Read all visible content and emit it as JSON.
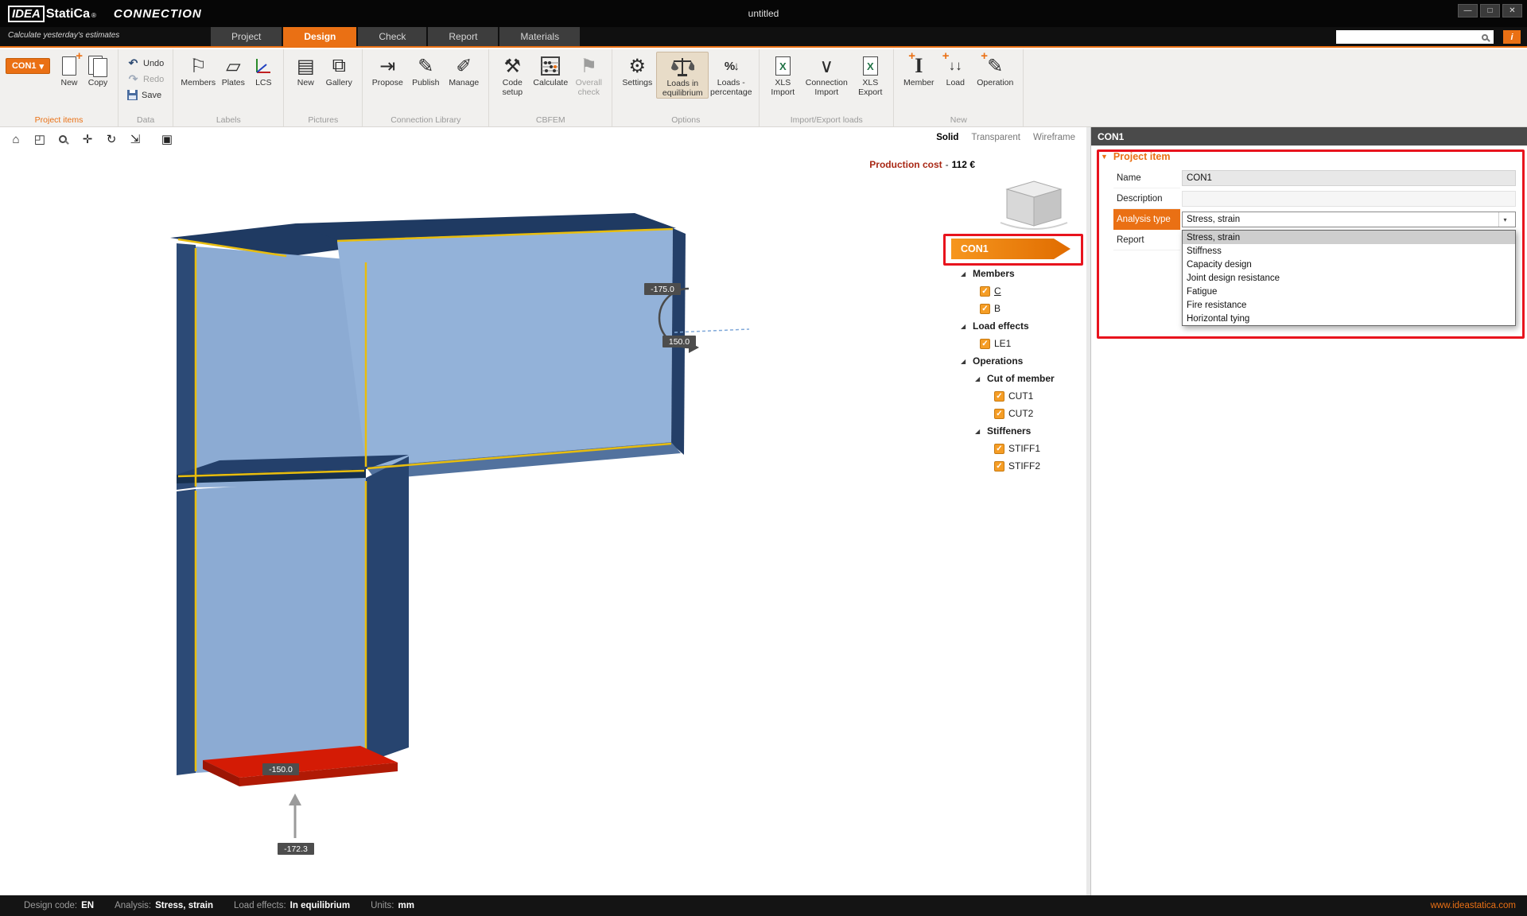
{
  "app": {
    "logo_idea": "IDEA",
    "logo_statica": "StatiCa",
    "logo_reg": "®",
    "product": "CONNECTION",
    "tagline": "Calculate yesterday's estimates",
    "window_title": "untitled"
  },
  "tabs": {
    "project": "Project",
    "design": "Design",
    "check": "Check",
    "report": "Report",
    "materials": "Materials"
  },
  "ribbon": {
    "project_items": {
      "label": "Project items",
      "con1_button": "CON1",
      "new": "New",
      "copy": "Copy"
    },
    "data": {
      "label": "Data",
      "undo": "Undo",
      "redo": "Redo",
      "save": "Save"
    },
    "labels": {
      "label": "Labels",
      "members": "Members",
      "plates": "Plates",
      "lcs": "LCS"
    },
    "pictures": {
      "label": "Pictures",
      "new": "New",
      "gallery": "Gallery"
    },
    "connection_library": {
      "label": "Connection Library",
      "propose": "Propose",
      "publish": "Publish",
      "manage": "Manage"
    },
    "cbfem": {
      "label": "CBFEM",
      "code_setup": "Code setup",
      "calculate": "Calculate",
      "overall_check": "Overall check"
    },
    "options": {
      "label": "Options",
      "settings": "Settings",
      "loads_equilibrium": "Loads in equilibrium",
      "loads_percentage": "Loads - percentage"
    },
    "import_export": {
      "label": "Import/Export loads",
      "xls_import": "XLS Import",
      "connection_import": "Connection Import",
      "xls_export": "XLS Export"
    },
    "new": {
      "label": "New",
      "member": "Member",
      "load": "Load",
      "operation": "Operation"
    }
  },
  "viewport": {
    "production_cost_label": "Production cost",
    "production_cost_sep": "-",
    "production_cost_value": "112 €",
    "view_modes": {
      "solid": "Solid",
      "transparent": "Transparent",
      "wireframe": "Wireframe"
    },
    "load_labels": {
      "moment_top": "-175.0",
      "moment_bottom": "150.0",
      "plate": "-150.0",
      "base": "-172.3"
    }
  },
  "tree": {
    "root": "CON1",
    "members_group": "Members",
    "member_c": "C",
    "member_b": "B",
    "load_effects_group": "Load effects",
    "le1": "LE1",
    "operations_group": "Operations",
    "cut_group": "Cut of member",
    "cut1": "CUT1",
    "cut2": "CUT2",
    "stiffeners_group": "Stiffeners",
    "stiff1": "STIFF1",
    "stiff2": "STIFF2"
  },
  "properties": {
    "header": "CON1",
    "section_title": "Project item",
    "name_label": "Name",
    "name_value": "CON1",
    "description_label": "Description",
    "analysis_label": "Analysis type",
    "analysis_value": "Stress, strain",
    "report_label": "Report",
    "dropdown_options": [
      "Stress, strain",
      "Stiffness",
      "Capacity design",
      "Joint design resistance",
      "Fatigue",
      "Fire resistance",
      "Horizontal tying"
    ]
  },
  "status_bar": {
    "design_code_label": "Design code:",
    "design_code_value": "EN",
    "analysis_label": "Analysis:",
    "analysis_value": "Stress, strain",
    "load_effects_label": "Load effects:",
    "load_effects_value": "In equilibrium",
    "units_label": "Units:",
    "units_value": "mm",
    "website": "www.ideastatica.com"
  },
  "colors": {
    "accent_orange": "#ea7014",
    "annotation_red": "#e8131d",
    "steel_light": "#8cabd3",
    "steel_light2": "#93b2d9",
    "steel_mid": "#52729e",
    "steel_dark": "#2c4a76",
    "steel_navy": "#1f3a62",
    "weld_yellow": "#e8bd0e",
    "plate_red": "#d41b05",
    "plate_red_dark": "#9c1504",
    "badge_grey": "#4d4d4d"
  },
  "icons": {
    "minimize": "—",
    "restore": "□",
    "close": "✕",
    "help": "i",
    "dropdown": "▾",
    "plus": "+",
    "undo": "↶",
    "redo": "↷",
    "save": "css-floppy",
    "member_tag": "⚐",
    "plate": "▱",
    "lcs": "svg-axes",
    "picture": "▤",
    "gallery": "⧉",
    "propose": "⇥",
    "publish": "✎",
    "manage": "✐",
    "code_setup": "⚒",
    "calculate": "svg-abacus",
    "overall_check": "⚑",
    "settings": "⚙",
    "balance": "svg-scales",
    "percent": "%",
    "arrow_down": "↓",
    "xls": "X",
    "connection_import": "∨",
    "member_beam": "I",
    "load_arrows": "↓↓",
    "pencil": "✎",
    "doc_new": "css-document",
    "copy": "css-document-stack",
    "home": "⌂",
    "zoom_window": "◰",
    "search": "css-magnifier",
    "pan": "✛",
    "rotate": "↻",
    "fit": "⇲",
    "solid_box": "▣",
    "expander": "◢",
    "check": "✓",
    "section_triangle": "▼"
  }
}
